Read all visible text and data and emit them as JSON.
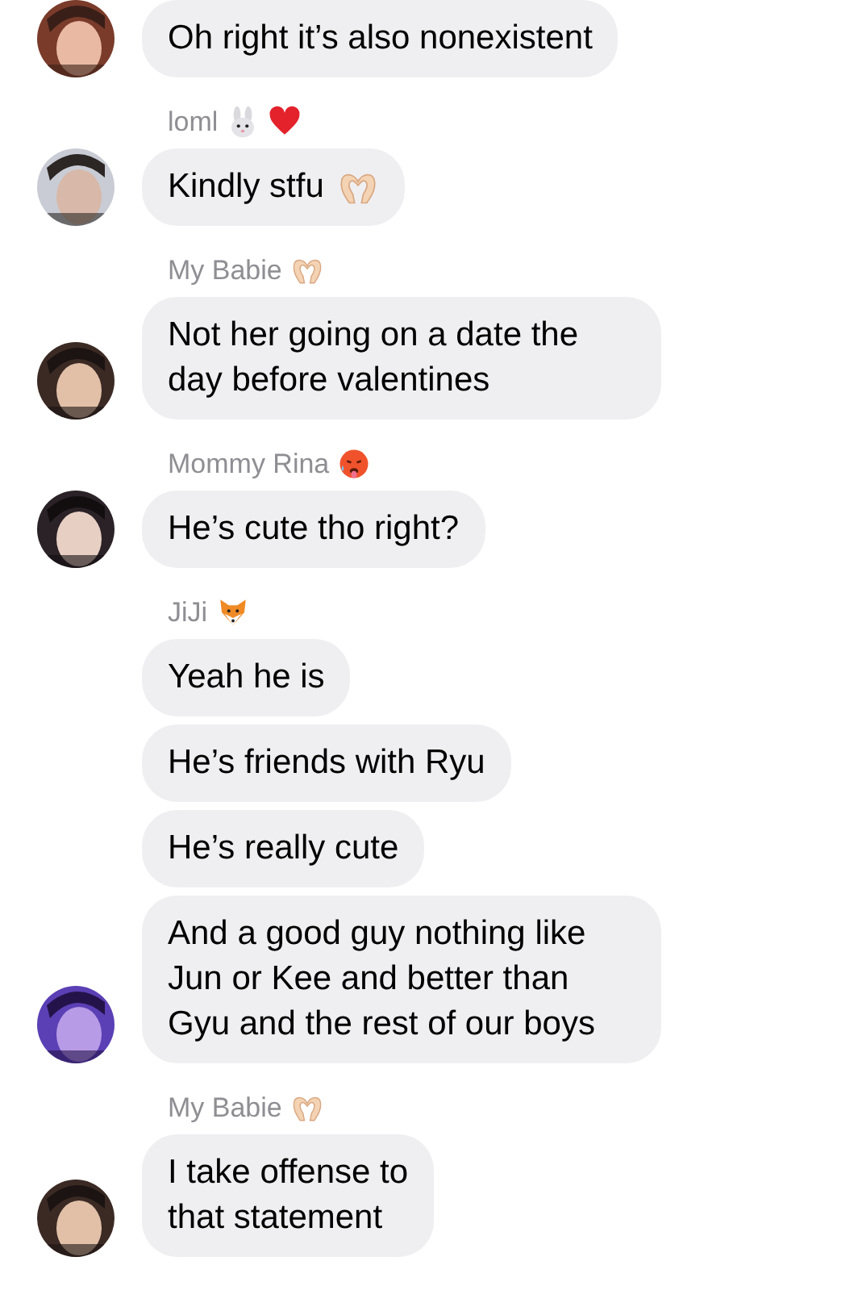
{
  "groups": [
    {
      "messages": [
        {
          "text": "Oh right it’s also nonexistent"
        }
      ]
    },
    {
      "sender": "loml",
      "sender_emoji": [
        {
          "kind": "rabbit"
        },
        {
          "kind": "heart"
        }
      ],
      "messages": [
        {
          "text": "Kindly stfu",
          "emoji": {
            "kind": "heart-hands"
          }
        }
      ]
    },
    {
      "sender": "My Babie",
      "sender_emoji": [
        {
          "kind": "heart-hands"
        }
      ],
      "messages": [
        {
          "text": "Not her going on a date the day before valentines"
        }
      ]
    },
    {
      "sender": "Mommy Rina",
      "sender_emoji": [
        {
          "kind": "hot-face"
        }
      ],
      "messages": [
        {
          "text": "He’s cute tho right?"
        }
      ]
    },
    {
      "sender": "JiJi",
      "sender_emoji": [
        {
          "kind": "fox"
        }
      ],
      "messages": [
        {
          "text": "Yeah he is"
        },
        {
          "text": "He’s friends with Ryu"
        },
        {
          "text": "He’s really cute"
        },
        {
          "text": "And a good guy nothing like Jun or Kee and better than Gyu and the rest of our boys"
        }
      ]
    },
    {
      "sender": "My Babie",
      "sender_emoji": [
        {
          "kind": "heart-hands"
        }
      ],
      "messages": [
        {
          "text": "I take offense to\nthat statement"
        }
      ]
    }
  ]
}
